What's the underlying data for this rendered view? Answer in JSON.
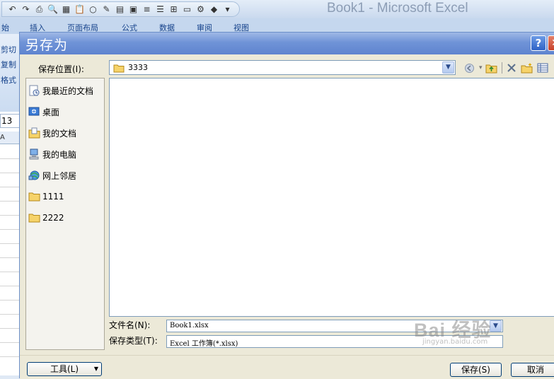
{
  "excel": {
    "title": "Book1 - Microsoft Excel",
    "tabs": [
      "始",
      "插入",
      "页面布局",
      "公式",
      "数据",
      "审阅",
      "视图"
    ],
    "clipboard": [
      "剪切",
      "复制",
      "格式"
    ],
    "namebox": "13",
    "column_header": "A",
    "qat_icons": [
      "undo-icon",
      "redo-icon",
      "print-icon",
      "print-preview-icon",
      "grid-icon",
      "paste-icon",
      "disc-icon",
      "brush-icon",
      "form-icon",
      "table-icon",
      "align-left-icon",
      "align-center-icon",
      "border-icon",
      "doc-icon",
      "chart-icon",
      "fill-color-icon",
      "more-icon"
    ]
  },
  "dialog": {
    "title": "另存为",
    "help_glyph": "?",
    "close_glyph": "✕",
    "save_in_label": "保存位置(I):",
    "location_value": "3333",
    "places": [
      {
        "label": "我最近的文档",
        "icon": "recent-docs-icon"
      },
      {
        "label": "桌面",
        "icon": "desktop-icon"
      },
      {
        "label": "我的文档",
        "icon": "my-documents-icon"
      },
      {
        "label": "我的电脑",
        "icon": "my-computer-icon"
      },
      {
        "label": "网上邻居",
        "icon": "network-icon"
      },
      {
        "label": "1111",
        "icon": "folder-icon"
      },
      {
        "label": "2222",
        "icon": "folder-icon"
      }
    ],
    "filename_label": "文件名(N):",
    "filename_value": "Book1.xlsx",
    "filetype_label": "保存类型(T):",
    "filetype_value": "Excel 工作簿(*.xlsx)",
    "tools_label": "工具(L)",
    "save_label": "保存(S)",
    "cancel_label": "取消",
    "watermark_main": "Bai 经验",
    "watermark_sub": "jingyan.baidu.com"
  }
}
